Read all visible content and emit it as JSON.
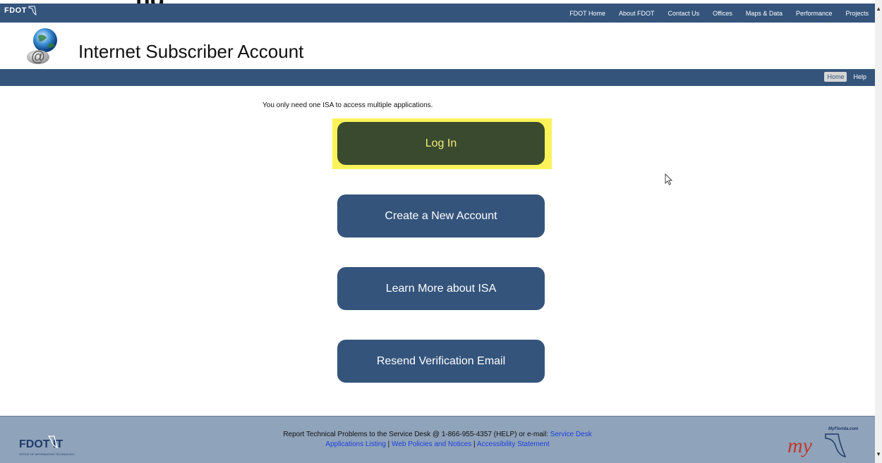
{
  "top_cut_heading": "ng",
  "topnav": {
    "logo": "FDOT",
    "links": [
      "FDOT Home",
      "About FDOT",
      "Contact Us",
      "Offices",
      "Maps & Data",
      "Performance",
      "Projects"
    ]
  },
  "header": {
    "title": "Internet Subscriber Account"
  },
  "subnav": {
    "home": "Home",
    "help": "Help"
  },
  "main": {
    "intro": "You only need one ISA to access multiple applications.",
    "buttons": {
      "login": "Log In",
      "create": "Create a New Account",
      "learn": "Learn More about ISA",
      "resend": "Resend Verification Email"
    }
  },
  "footer": {
    "report_text": "Report Technical Problems to the Service Desk @ 1-866-955-4357 (HELP) or e-mail: ",
    "service_desk": "Service Desk",
    "applications": "Applications Listing",
    "policies": "Web Policies and Notices",
    "accessibility": "Accessibility Statement",
    "separator": " | ",
    "logo_left": "FDOT IT",
    "logo_left_sub": "OFFICE OF INFORMATION TECHNOLOGY",
    "logo_right_site": "MyFlorida.com",
    "logo_right": "my"
  },
  "colors": {
    "nav_blue": "#34547c",
    "login_green": "#3a4a2e",
    "highlight_yellow": "#fcf35a",
    "footer_gray_blue": "#8fa3ba",
    "link_blue": "#1b3fe0"
  }
}
